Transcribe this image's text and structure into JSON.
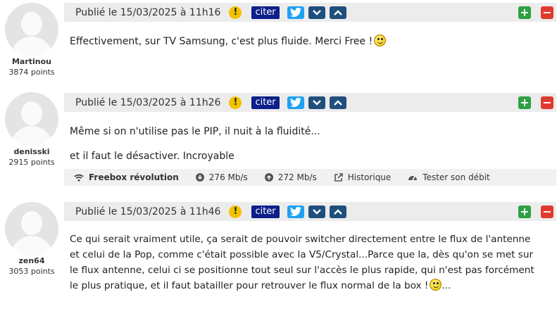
{
  "common": {
    "citer_label": "citer"
  },
  "posts": [
    {
      "username": "Martinou",
      "points": "3874 points",
      "published": "Publié le 15/03/2025 à 11h16",
      "lines": [
        "Effectivement, sur TV Samsung, c'est plus fluide. Merci Free !"
      ]
    },
    {
      "username": "denisski",
      "points": "2915 points",
      "published": "Publié le 15/03/2025 à 11h26",
      "lines": [
        "Même si on n'utilise pas le PIP, il nuit à la fluidité...",
        "et il faut le désactiver. Incroyable"
      ],
      "connection": {
        "box": "Freebox révolution",
        "down": "276 Mb/s",
        "up": "272 Mb/s",
        "history": "Historique",
        "test": "Tester son débit"
      }
    },
    {
      "username": "zen64",
      "points": "3053 points",
      "published": "Publié le 15/03/2025 à 11h46",
      "lines": [
        "Ce qui serait vraiment utile, ça serait de pouvoir switcher directement entre le flux de l'antenne",
        "et celui de la Pop, comme c'était possible avec la V5/Crystal...Parce que la, dès qu'on se met sur",
        "le flux antenne, celui ci  se positionne tout seul sur l'accès le plus rapide, qui n'est pas forcément",
        "le plus pratique, et il faut batailler pour retrouver le flux normal de la box !"
      ],
      "tail": "..."
    }
  ]
}
